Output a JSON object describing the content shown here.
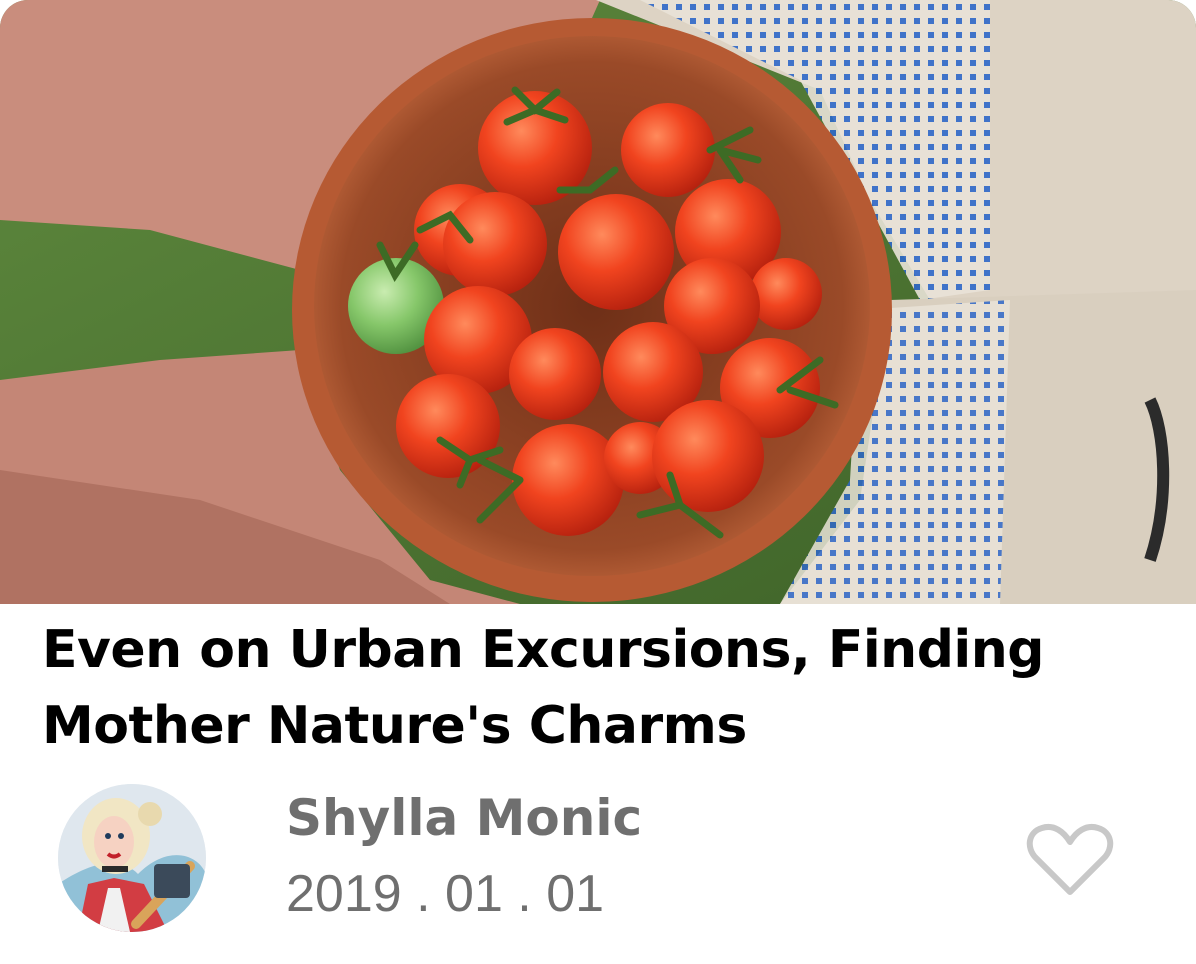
{
  "article": {
    "title": "Even on Urban Excursions, Finding Mother Nature's Charms",
    "image_alt": "Hands holding a clay bowl of cherry tomatoes"
  },
  "author": {
    "name": "Shylla Monic",
    "date": "2019 . 01 . 01"
  },
  "icons": {
    "like": "heart-outline-icon",
    "avatar": "avatar"
  },
  "colors": {
    "title": "#000000",
    "meta": "#6f6f6f",
    "heart": "#c8c8c8"
  }
}
